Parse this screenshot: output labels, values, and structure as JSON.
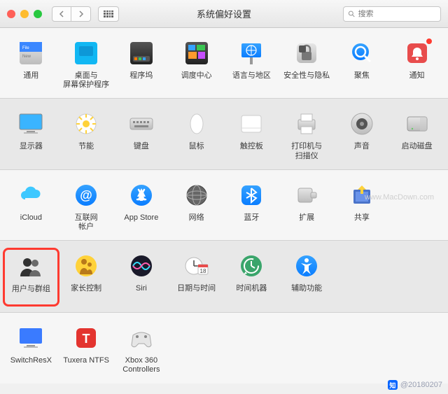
{
  "window": {
    "title": "系统偏好设置"
  },
  "search": {
    "placeholder": "搜索"
  },
  "rows": [
    [
      {
        "id": "general",
        "label": "通用"
      },
      {
        "id": "desktop",
        "label": "桌面与\n屏幕保护程序"
      },
      {
        "id": "dock",
        "label": "程序坞"
      },
      {
        "id": "mission",
        "label": "调度中心"
      },
      {
        "id": "language",
        "label": "语言与地区"
      },
      {
        "id": "security",
        "label": "安全性与隐私"
      },
      {
        "id": "spotlight",
        "label": "聚焦"
      },
      {
        "id": "notifications",
        "label": "通知"
      }
    ],
    [
      {
        "id": "displays",
        "label": "显示器"
      },
      {
        "id": "energy",
        "label": "节能"
      },
      {
        "id": "keyboard",
        "label": "键盘"
      },
      {
        "id": "mouse",
        "label": "鼠标"
      },
      {
        "id": "trackpad",
        "label": "触控板"
      },
      {
        "id": "printers",
        "label": "打印机与\n扫描仪"
      },
      {
        "id": "sound",
        "label": "声音"
      },
      {
        "id": "startup",
        "label": "启动磁盘"
      }
    ],
    [
      {
        "id": "icloud",
        "label": "iCloud"
      },
      {
        "id": "internet",
        "label": "互联网\n帐户"
      },
      {
        "id": "appstore",
        "label": "App Store"
      },
      {
        "id": "network",
        "label": "网络"
      },
      {
        "id": "bluetooth",
        "label": "蓝牙"
      },
      {
        "id": "extensions",
        "label": "扩展"
      },
      {
        "id": "sharing",
        "label": "共享"
      }
    ],
    [
      {
        "id": "users",
        "label": "用户与群组",
        "highlight": true
      },
      {
        "id": "parental",
        "label": "家长控制"
      },
      {
        "id": "siri",
        "label": "Siri"
      },
      {
        "id": "datetime",
        "label": "日期与时间"
      },
      {
        "id": "timemachine",
        "label": "时间机器"
      },
      {
        "id": "accessibility",
        "label": "辅助功能"
      }
    ],
    [
      {
        "id": "switchresx",
        "label": "SwitchResX"
      },
      {
        "id": "tuxera",
        "label": "Tuxera NTFS"
      },
      {
        "id": "xbox",
        "label": "Xbox 360\nControllers"
      }
    ]
  ],
  "watermark": "www.MacDown.com",
  "credit": "@20180207"
}
